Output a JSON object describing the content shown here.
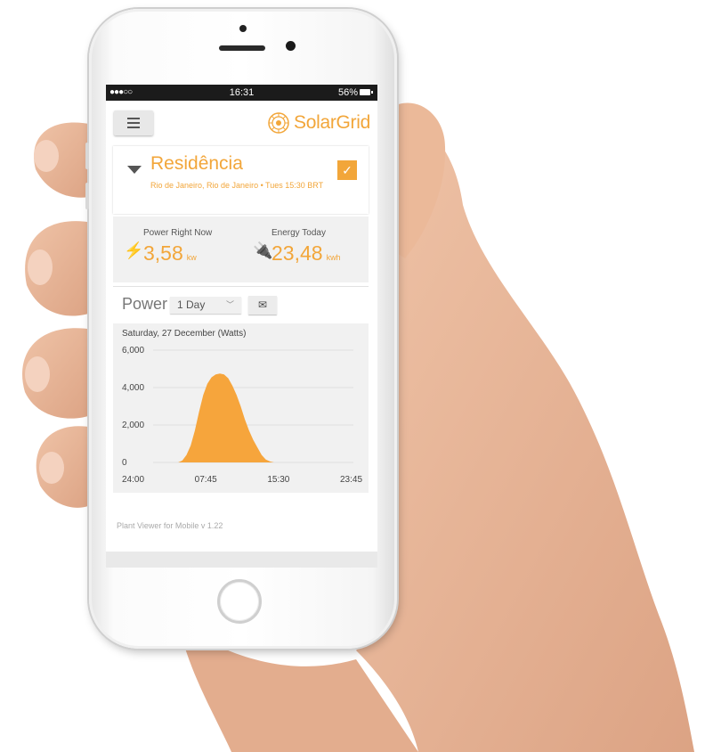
{
  "status_bar": {
    "signal": "●●●○○",
    "time": "16:31",
    "battery": "56%"
  },
  "header": {
    "brand": "SolarGrid"
  },
  "site": {
    "name": "Residência",
    "location": "Rio de Janeiro, Rio de Janeiro • Tues 15:30 BRT"
  },
  "stats": {
    "power": {
      "label": "Power Right Now",
      "value": "3,58",
      "unit": "kw"
    },
    "energy": {
      "label": "Energy Today",
      "value": "23,48",
      "unit": "kwh"
    }
  },
  "power_section": {
    "title": "Power",
    "range": "1 Day"
  },
  "chart_data": {
    "type": "area",
    "title": "Saturday, 27 December (Watts)",
    "x_ticks": [
      "24:00",
      "07:45",
      "15:30",
      "23:45"
    ],
    "y_ticks": [
      "0",
      "2,000",
      "4,000",
      "6,000"
    ],
    "ylim": [
      0,
      6000
    ],
    "x": [
      0,
      3,
      3.5,
      4,
      4.5,
      5,
      5.5,
      6,
      6.5,
      7,
      7.5,
      8,
      8.5,
      9,
      9.5,
      10,
      10.5,
      11,
      11.5,
      12,
      12.5,
      13,
      13.5,
      14,
      14.5,
      15,
      24
    ],
    "values": [
      0,
      0,
      100,
      400,
      900,
      1700,
      2700,
      3600,
      4200,
      4550,
      4700,
      4750,
      4700,
      4500,
      4100,
      3600,
      3000,
      2300,
      1700,
      1200,
      800,
      400,
      150,
      50,
      0,
      0,
      0
    ],
    "color": "#f6a53c"
  },
  "footer": {
    "version": "Plant Viewer for Mobile v 1.22"
  }
}
